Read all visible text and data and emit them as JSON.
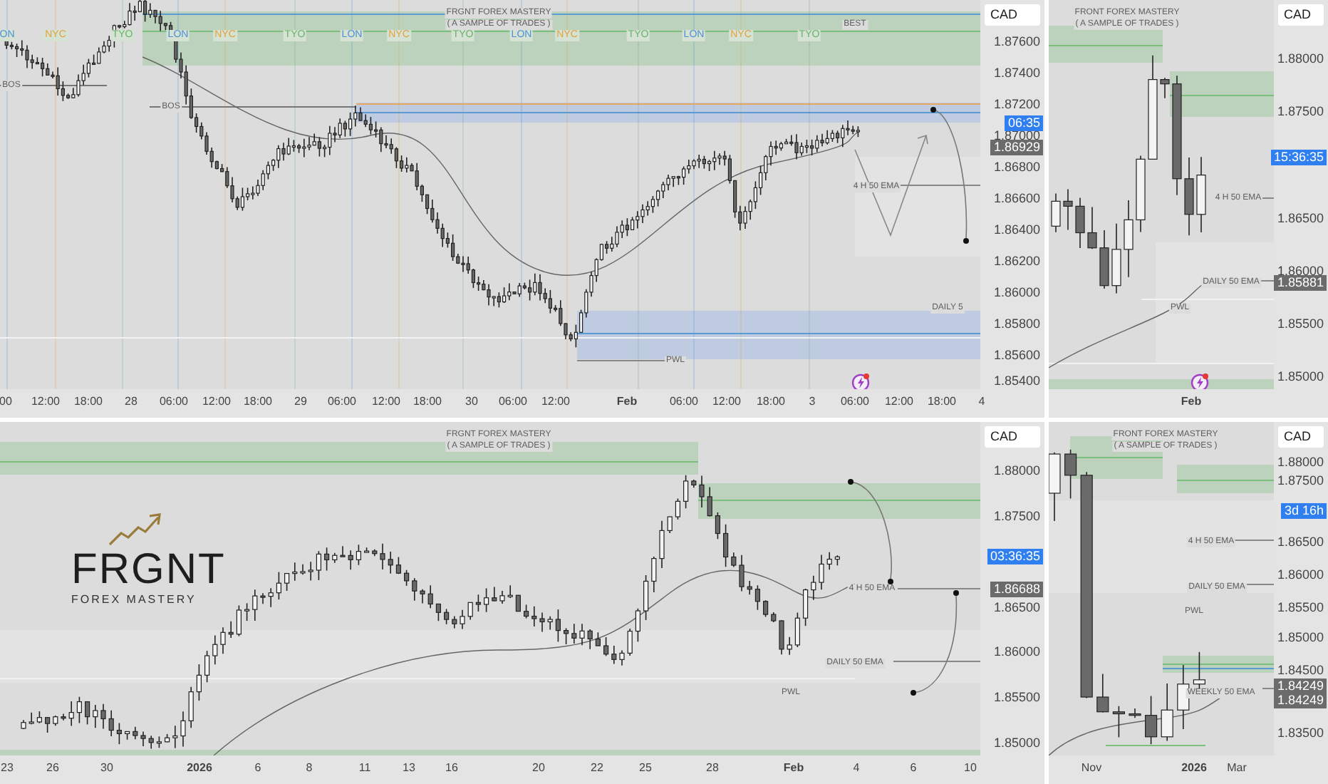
{
  "panels": [
    {
      "currency": "CAD",
      "alert": true,
      "title": "FRGNT FOREX MASTERY",
      "subtitle": "( A SAMPLE OF TRADES )",
      "price_ticks": [
        "1.87600",
        "1.87400",
        "1.87200",
        "1.87000",
        "1.86800",
        "1.86600",
        "1.86400",
        "1.86200",
        "1.86000",
        "1.85800",
        "1.85600",
        "1.85400"
      ],
      "price_tags": [
        {
          "text": "06:35",
          "kind": "countdown"
        },
        {
          "text": "1.86929",
          "kind": "price"
        }
      ],
      "time_ticks": [
        {
          "text": "00",
          "major": false
        },
        {
          "text": "12:00",
          "major": false
        },
        {
          "text": "18:00",
          "major": false
        },
        {
          "text": "28",
          "major": false
        },
        {
          "text": "06:00",
          "major": false
        },
        {
          "text": "12:00",
          "major": false
        },
        {
          "text": "18:00",
          "major": false
        },
        {
          "text": "29",
          "major": false
        },
        {
          "text": "06:00",
          "major": false
        },
        {
          "text": "12:00",
          "major": false
        },
        {
          "text": "18:00",
          "major": false
        },
        {
          "text": "30",
          "major": false
        },
        {
          "text": "06:00",
          "major": false
        },
        {
          "text": "12:00",
          "major": false
        },
        {
          "text": "Feb",
          "major": true
        },
        {
          "text": "06:00",
          "major": false
        },
        {
          "text": "12:00",
          "major": false
        },
        {
          "text": "18:00",
          "major": false
        },
        {
          "text": "3",
          "major": false
        },
        {
          "text": "06:00",
          "major": false
        },
        {
          "text": "12:00",
          "major": false
        },
        {
          "text": "18:00",
          "major": false
        },
        {
          "text": "4",
          "major": false
        }
      ],
      "sessions": [
        {
          "text": "ON",
          "kind": "london"
        },
        {
          "text": "NYC",
          "kind": "newyork"
        },
        {
          "text": "TYO",
          "kind": "tokyo"
        },
        {
          "text": "LON",
          "kind": "london"
        },
        {
          "text": "NYC",
          "kind": "newyork"
        },
        {
          "text": "TYO",
          "kind": "tokyo"
        },
        {
          "text": "LON",
          "kind": "london"
        },
        {
          "text": "NYC",
          "kind": "newyork"
        },
        {
          "text": "TYO",
          "kind": "tokyo"
        },
        {
          "text": "LON",
          "kind": "london"
        },
        {
          "text": "NYC",
          "kind": "newyork"
        },
        {
          "text": "TYO",
          "kind": "tokyo"
        },
        {
          "text": "LON",
          "kind": "london"
        },
        {
          "text": "NYC",
          "kind": "newyork"
        },
        {
          "text": "TYO",
          "kind": "tokyo"
        }
      ],
      "annotations": [
        "BEST",
        "BOS",
        "BOS",
        "4 H 50 EMA",
        "DAILY 5",
        "PWL"
      ]
    },
    {
      "currency": "CAD",
      "alert": true,
      "title": "FRONT FOREX MASTERY",
      "subtitle": "( A SAMPLE OF TRADES )",
      "price_ticks": [
        "1.88000",
        "1.87500",
        "1.86500",
        "1.86000",
        "1.85500",
        "1.85000"
      ],
      "price_tags": [
        {
          "text": "15:36:35",
          "kind": "countdown"
        },
        {
          "text": "1.85881",
          "kind": "price"
        }
      ],
      "time_ticks": [
        {
          "text": "Feb",
          "major": true
        }
      ],
      "annotations": [
        "4 H 50 EMA",
        "DAILY 50 EMA",
        "PWL"
      ]
    },
    {
      "currency": "CAD",
      "title": "FRGNT FOREX MASTERY",
      "subtitle": "( A SAMPLE OF TRADES )",
      "price_ticks": [
        "1.88000",
        "1.87500",
        "1.86500",
        "1.86000",
        "1.85500",
        "1.85000"
      ],
      "price_tags": [
        {
          "text": "03:36:35",
          "kind": "countdown"
        },
        {
          "text": "1.86688",
          "kind": "price"
        }
      ],
      "time_ticks": [
        {
          "text": "23",
          "major": false
        },
        {
          "text": "26",
          "major": false
        },
        {
          "text": "30",
          "major": false
        },
        {
          "text": "2026",
          "major": true
        },
        {
          "text": "6",
          "major": false
        },
        {
          "text": "8",
          "major": false
        },
        {
          "text": "11",
          "major": false
        },
        {
          "text": "13",
          "major": false
        },
        {
          "text": "16",
          "major": false
        },
        {
          "text": "20",
          "major": false
        },
        {
          "text": "22",
          "major": false
        },
        {
          "text": "25",
          "major": false
        },
        {
          "text": "28",
          "major": false
        },
        {
          "text": "Feb",
          "major": true
        },
        {
          "text": "4",
          "major": false
        },
        {
          "text": "6",
          "major": false
        },
        {
          "text": "10",
          "major": false
        }
      ],
      "annotations": [
        "4 H 50 EMA",
        "DAILY 50 EMA",
        "PWL"
      ],
      "logo": {
        "name": "FRGNT",
        "tagline": "FOREX MASTERY"
      }
    },
    {
      "currency": "CAD",
      "title": "FRONT FOREX MASTERY",
      "subtitle": "( A SAMPLE OF TRADES )",
      "price_ticks": [
        "1.88000",
        "1.87500",
        "1.86500",
        "1.86000",
        "1.85500",
        "1.85000",
        "1.84500",
        "1.83500"
      ],
      "price_tags": [
        {
          "text": "3d 16h",
          "kind": "countdown"
        },
        {
          "text": "1.84249",
          "kind": "price"
        },
        {
          "text": "1.84249",
          "kind": "price"
        }
      ],
      "time_ticks": [
        {
          "text": "Nov",
          "major": false
        },
        {
          "text": "2026",
          "major": true
        },
        {
          "text": "Mar",
          "major": false
        }
      ],
      "annotations": [
        "4 H 50 EMA",
        "DAILY 50 EMA",
        "PWL",
        "WEEKLY 50 EMA"
      ]
    }
  ]
}
